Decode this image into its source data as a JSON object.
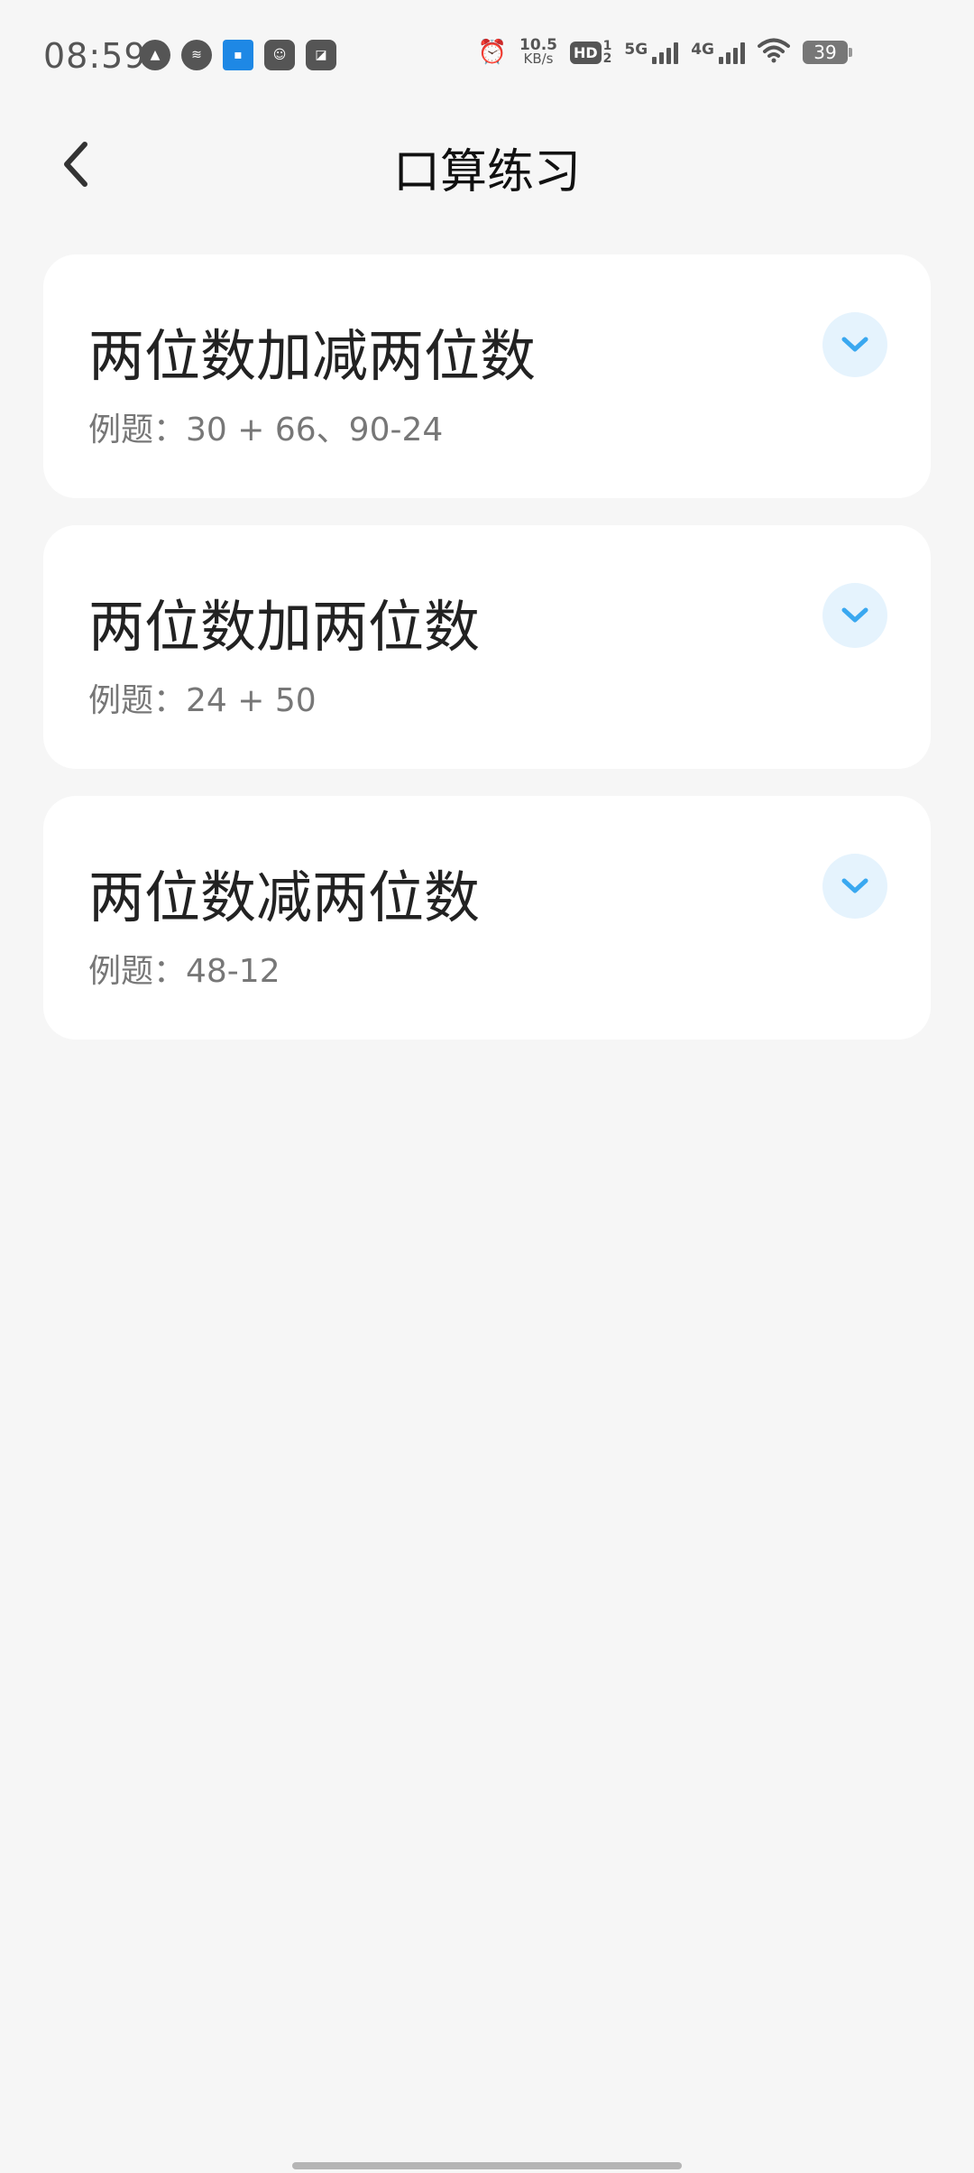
{
  "status_bar": {
    "time": "08:59",
    "net_speed_value": "10.5",
    "net_speed_unit": "KB/s",
    "hd_label": "HD",
    "hd_sub_top": "1",
    "hd_sub_bottom": "2",
    "network_5g": "5G",
    "network_4g": "4G",
    "battery": "39"
  },
  "header": {
    "title": "口算练习"
  },
  "cards": [
    {
      "title": "两位数加减两位数",
      "example": "例题：30 + 66、90-24"
    },
    {
      "title": "两位数加两位数",
      "example": "例题：24 + 50"
    },
    {
      "title": "两位数减两位数",
      "example": "例题：48-12"
    }
  ],
  "colors": {
    "background": "#f6f6f6",
    "card": "#ffffff",
    "accent": "#3aa8f0",
    "accent_bg": "#e5f3fd"
  }
}
